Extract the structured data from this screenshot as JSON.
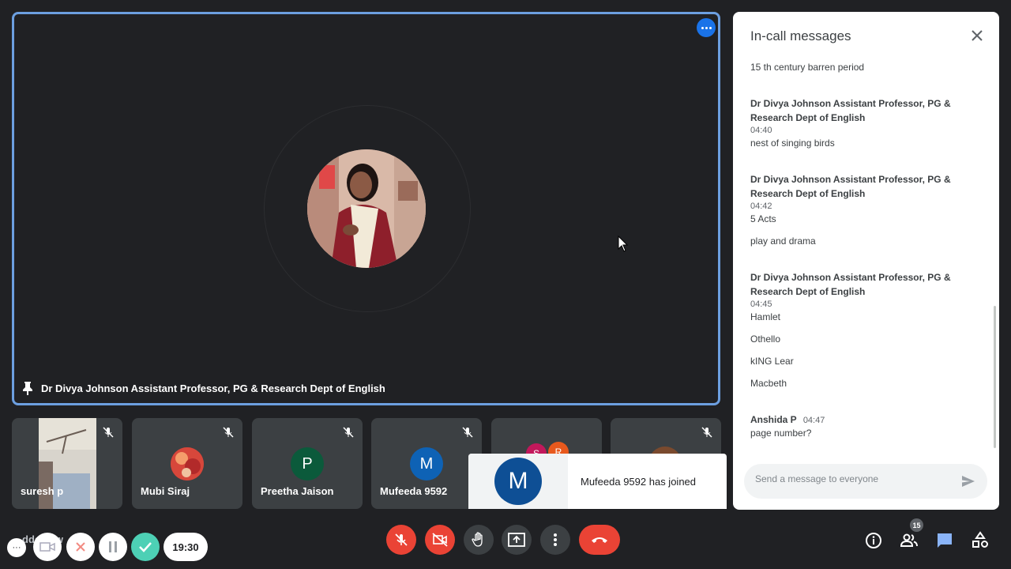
{
  "main_tile": {
    "presenter_name": "Dr Divya Johnson Assistant Professor, PG & Research Dept of English"
  },
  "thumbnails": [
    {
      "name": "suresh p"
    },
    {
      "name": "Mubi Siraj"
    },
    {
      "name": "Preetha Jaison",
      "initial": "P"
    },
    {
      "name": "Mufeeda 9592",
      "initial": "M"
    },
    {
      "name": "",
      "initials": [
        "S",
        "R"
      ]
    },
    {
      "name": ""
    }
  ],
  "toast": {
    "initial": "M",
    "text": "Mufeeda 9592 has joined"
  },
  "chat": {
    "title": "In-call messages",
    "messages": [
      {
        "lines": [
          "15 th century barren period"
        ]
      },
      {
        "sender": "Dr Divya Johnson Assistant Professor, PG & Research Dept of English",
        "time": "04:40",
        "lines": [
          "nest of singing birds"
        ]
      },
      {
        "sender": "Dr Divya Johnson Assistant Professor, PG & Research Dept of English",
        "time": "04:42",
        "lines": [
          "5 Acts",
          "play and drama"
        ]
      },
      {
        "sender": "Dr Divya Johnson Assistant Professor, PG & Research Dept of English",
        "time": "04:45",
        "lines": [
          "Hamlet",
          "Othello",
          "kING Lear",
          "Macbeth"
        ]
      },
      {
        "sender": "Anshida P",
        "time": "04:47",
        "lines": [
          "page number?"
        ]
      }
    ],
    "input_placeholder": "Send a message to everyone"
  },
  "overlay": {
    "timer": "19:30",
    "bg_text": "dde   ig     w"
  },
  "participants_count": "15",
  "colors": {
    "accent": "#1a73e8",
    "danger": "#ea4335",
    "surface": "#202124",
    "tile": "#3c4043"
  }
}
